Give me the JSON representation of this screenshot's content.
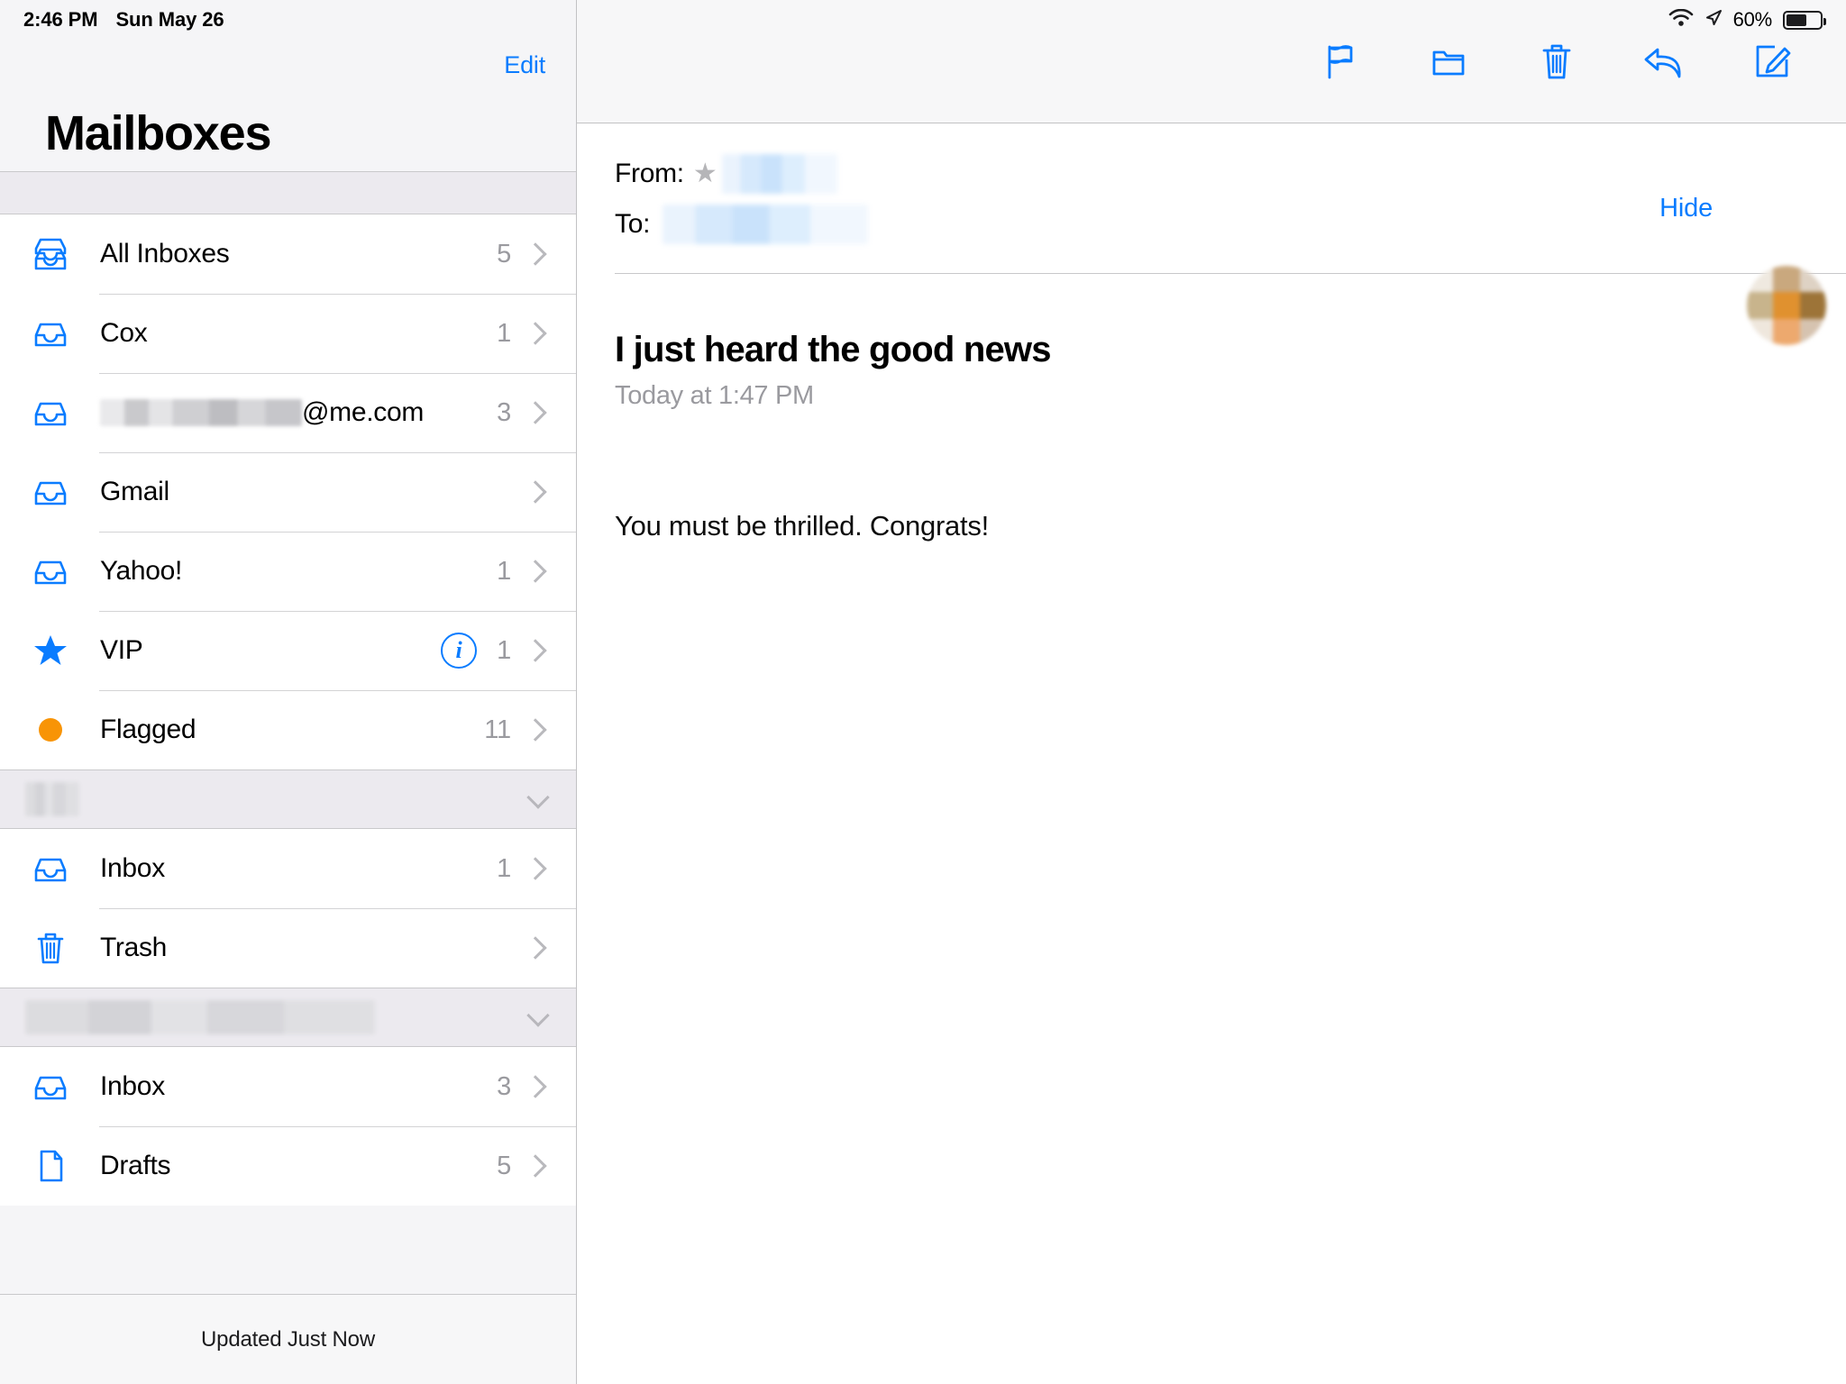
{
  "status_bar": {
    "time": "2:46 PM",
    "date": "Sun May 26",
    "wifi_icon": "wifi-icon",
    "location_icon": "location-arrow-icon",
    "battery_percent": "60%",
    "battery_level": 60
  },
  "sidebar": {
    "edit_label": "Edit",
    "title": "Mailboxes",
    "accounts": [
      {
        "label": "All Inboxes",
        "count": "5",
        "icon": "all-inboxes-icon",
        "redacted": false
      },
      {
        "label": "Cox",
        "count": "1",
        "icon": "inbox-icon",
        "redacted": false
      },
      {
        "label": "@me.com",
        "count": "3",
        "icon": "inbox-icon",
        "redacted": true
      },
      {
        "label": "Gmail",
        "count": "",
        "icon": "inbox-icon",
        "redacted": false
      },
      {
        "label": "Yahoo!",
        "count": "1",
        "icon": "inbox-icon",
        "redacted": false
      },
      {
        "label": "VIP",
        "count": "1",
        "icon": "star-icon",
        "redacted": false,
        "info_button": "i"
      },
      {
        "label": "Flagged",
        "count": "11",
        "icon": "orange-dot-icon",
        "redacted": false
      }
    ],
    "groups": [
      {
        "header_label": "",
        "header_redacted": true,
        "header_redact_width": 60,
        "rows": [
          {
            "label": "Inbox",
            "count": "1",
            "icon": "inbox-icon"
          },
          {
            "label": "Trash",
            "count": "",
            "icon": "trash-icon"
          }
        ]
      },
      {
        "header_label": "",
        "header_redacted": true,
        "header_redact_width": 388,
        "rows": [
          {
            "label": "Inbox",
            "count": "3",
            "icon": "inbox-icon"
          },
          {
            "label": "Drafts",
            "count": "5",
            "icon": "drafts-icon"
          }
        ]
      }
    ],
    "footer_status": "Updated Just Now"
  },
  "detail": {
    "toolbar": [
      {
        "name": "flag-icon",
        "label": "Flag"
      },
      {
        "name": "folder-icon",
        "label": "Move to folder"
      },
      {
        "name": "trash-icon",
        "label": "Delete"
      },
      {
        "name": "reply-icon",
        "label": "Reply"
      },
      {
        "name": "compose-icon",
        "label": "Compose"
      }
    ],
    "from_label": "From:",
    "from_value": "",
    "from_vip_star": "★",
    "to_label": "To:",
    "to_value": "",
    "hide_label": "Hide",
    "subject": "I just heard the good news",
    "date": "Today at 1:47 PM",
    "body": "You must be thrilled. Congrats!"
  },
  "colors": {
    "accent_blue": "#0a7cff",
    "flag_orange": "#f89406",
    "sidebar_bg": "#f5f5f7",
    "group_bg": "#eceaef",
    "secondary_text": "#9a9a9f"
  }
}
